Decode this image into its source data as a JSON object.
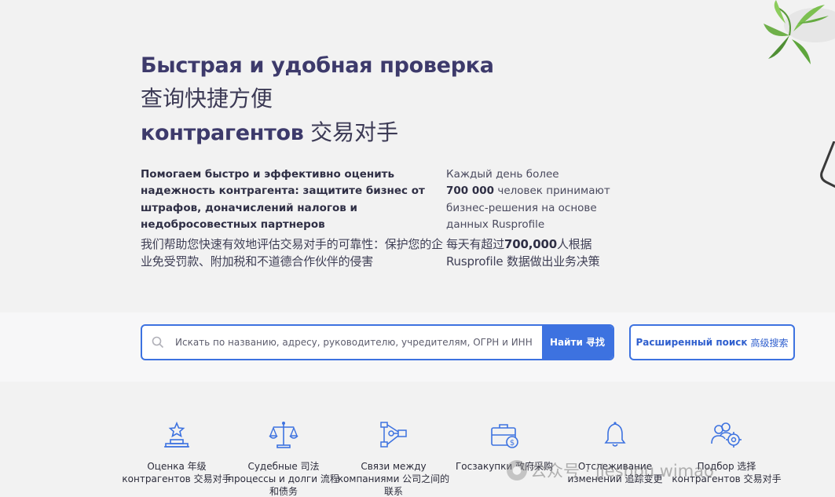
{
  "hero": {
    "line1": "Быстрая и удобная проверка",
    "line2": "查询快捷方便",
    "line3_ru": "контрагентов",
    "line3_cn": "交易对手"
  },
  "desc_left": {
    "ru": "Помогаем быстро и эффективно оценить надежность контрагента: защитите бизнес от штрафов, доначислений налогов и недобросовестных партнеров",
    "cn": "我们帮助您快速有效地评估交易对手的可靠性：保护您的企业免受罚款、附加税和不道德合作伙伴的侵害"
  },
  "desc_right": {
    "ru_pre": "Каждый день более",
    "ru_num": "700 000",
    "ru_post": "человек принимают бизнес-решения на основе данных Rusprofile",
    "cn_pre": "每天有超过",
    "cn_num": "700,000",
    "cn_post": "人根据 Rusprofile 数据做出业务决策"
  },
  "search": {
    "placeholder": "Искать по названию, адресу, руководителю, учредителям, ОГРН и ИНН",
    "button_label": "Найти 寻找",
    "advanced_ru": "Расширенный поиск",
    "advanced_cn": "高级搜索"
  },
  "features": [
    {
      "icon": "rating-pedestal-icon",
      "label": "Оценка  年级 контрагентов  交易对手"
    },
    {
      "icon": "scales-icon",
      "label": "Судебные  司法 процессы и долги  流程和债务"
    },
    {
      "icon": "network-icon",
      "label": "Связи между компаниями  公司之间的联系"
    },
    {
      "icon": "briefcase-money-icon",
      "label": "Госзакупки  政府采购"
    },
    {
      "icon": "bell-icon",
      "label": "Отслеживание изменений  追踪变更"
    },
    {
      "icon": "users-gear-icon",
      "label": "Подбор  选择 контрагентов  交易对手"
    }
  ],
  "watermark": "公众号 · jieshou wimao",
  "colors": {
    "accent": "#3d72e0",
    "title": "#3d3a6b",
    "background": "#f2f2f2"
  }
}
